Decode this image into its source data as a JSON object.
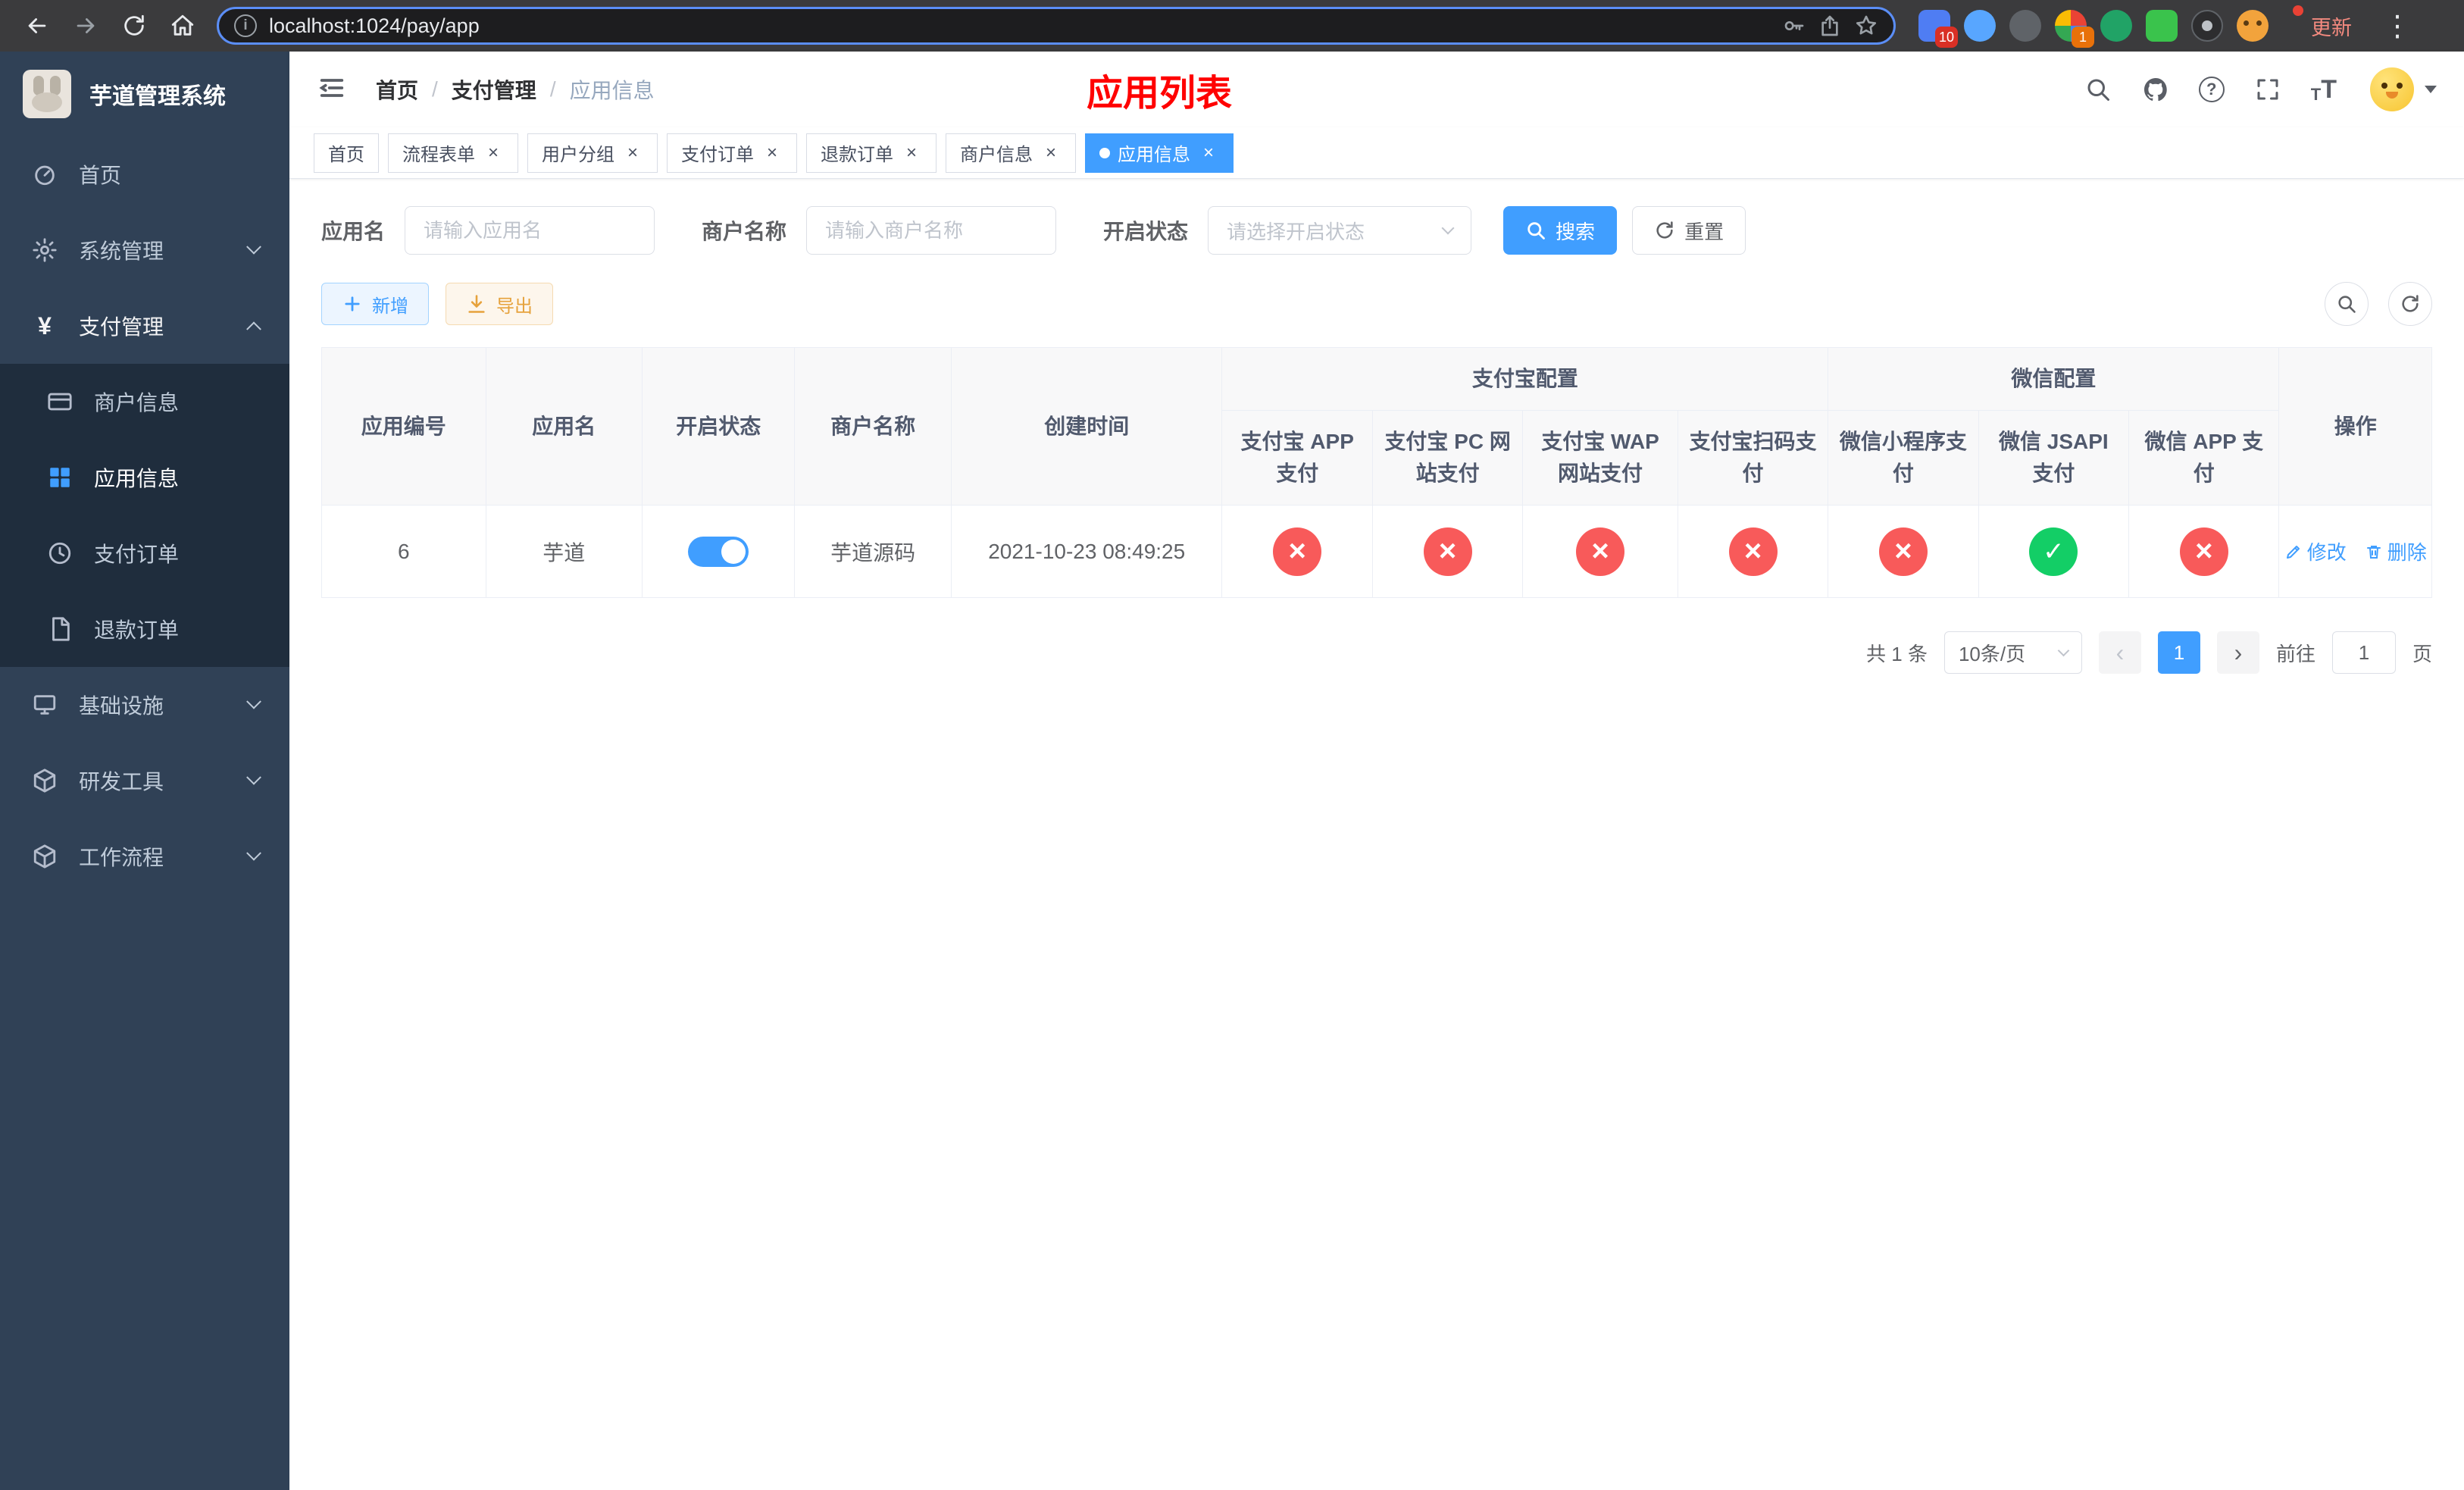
{
  "colors": {
    "primary": "#409eff",
    "danger": "#f85a5a",
    "success": "#13ce66",
    "warning": "#e6a23c",
    "title_red": "#ff0000",
    "sidebar_bg": "#304156",
    "submenu_bg": "#1f2d3d"
  },
  "browser": {
    "url": "localhost:1024/pay/app",
    "update_button": "更新",
    "ext_badge_1": "10",
    "ext_badge_2": "1"
  },
  "sidebar": {
    "app_title": "芋道管理系统",
    "items": [
      {
        "label": "首页"
      },
      {
        "label": "系统管理"
      },
      {
        "label": "支付管理",
        "children": [
          {
            "label": "商户信息"
          },
          {
            "label": "应用信息"
          },
          {
            "label": "支付订单"
          },
          {
            "label": "退款订单"
          }
        ]
      },
      {
        "label": "基础设施"
      },
      {
        "label": "研发工具"
      },
      {
        "label": "工作流程"
      }
    ]
  },
  "navbar": {
    "breadcrumb": {
      "home": "首页",
      "separator": "/",
      "section": "支付管理",
      "current": "应用信息"
    },
    "page_title": "应用列表"
  },
  "tabs": [
    {
      "label": "首页"
    },
    {
      "label": "流程表单"
    },
    {
      "label": "用户分组"
    },
    {
      "label": "支付订单"
    },
    {
      "label": "退款订单"
    },
    {
      "label": "商户信息"
    },
    {
      "label": "应用信息"
    }
  ],
  "filter": {
    "app_name_label": "应用名",
    "app_name_placeholder": "请输入应用名",
    "merchant_label": "商户名称",
    "merchant_placeholder": "请输入商户名称",
    "status_label": "开启状态",
    "status_placeholder": "请选择开启状态",
    "search_button": "搜索",
    "reset_button": "重置"
  },
  "toolbar": {
    "add_button": "新增",
    "export_button": "导出"
  },
  "table": {
    "groups": {
      "alipay": "支付宝配置",
      "wechat": "微信配置"
    },
    "columns": [
      "应用编号",
      "应用名",
      "开启状态",
      "商户名称",
      "创建时间",
      "支付宝 APP 支付",
      "支付宝 PC 网站支付",
      "支付宝 WAP 网站支付",
      "支付宝扫码支付",
      "微信小程序支付",
      "微信 JSAPI 支付",
      "微信 APP 支付",
      "操作"
    ],
    "rows": [
      {
        "id": "6",
        "name": "芋道",
        "status_on": true,
        "merchant": "芋道源码",
        "created_at": "2021-10-23 08:49:25",
        "configs": [
          "no",
          "no",
          "no",
          "no",
          "no",
          "yes",
          "no"
        ],
        "edit_label": "修改",
        "delete_label": "删除"
      }
    ]
  },
  "pagination": {
    "total": "共 1 条",
    "page_size": "10条/页",
    "page": "1",
    "goto_prefix": "前往",
    "goto_value": "1",
    "goto_suffix": "页"
  }
}
